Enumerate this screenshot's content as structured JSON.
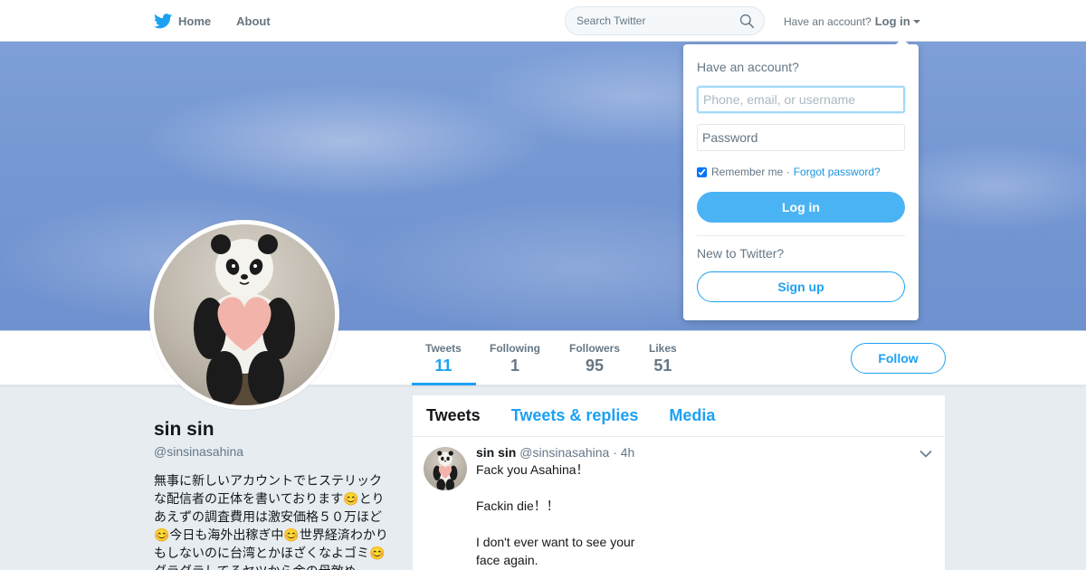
{
  "nav": {
    "home_label": "Home",
    "about_label": "About",
    "search_placeholder": "Search Twitter",
    "account_prompt": "Have an account?",
    "login_label": "Log in"
  },
  "profile": {
    "name": "sin sin",
    "handle": "@sinsinasahina",
    "bio": "無事に新しいアカウントでヒステリックな配信者の正体を書いております😊とりあえずの調査費用は激安価格５０万ほど😊今日も海外出稼ぎ中😊世界経済わかりもしないのに台湾とかほざくなよゴミ😊ダラダラしてるヤツから金の母敵め"
  },
  "stats": [
    {
      "label": "Tweets",
      "value": "11"
    },
    {
      "label": "Following",
      "value": "1"
    },
    {
      "label": "Followers",
      "value": "95"
    },
    {
      "label": "Likes",
      "value": "51"
    }
  ],
  "follow_label": "Follow",
  "timeline": {
    "tabs": [
      "Tweets",
      "Tweets & replies",
      "Media"
    ],
    "active_tab": "Tweets",
    "tweets": [
      {
        "name": "sin sin",
        "handle": "@sinsinasahina",
        "time": "· 4h",
        "text": "Fack you Asahina！\n\nFackin die！！\n\nI don't ever want to see your\nface again."
      }
    ]
  },
  "login_dropdown": {
    "title": "Have an account?",
    "username_placeholder": "Phone, email, or username",
    "password_placeholder": "Password",
    "remember_label": "Remember me ·",
    "forgot_label": "Forgot password?",
    "login_button": "Log in",
    "new_prompt": "New to Twitter?",
    "signup_button": "Sign up"
  },
  "colors": {
    "brand_blue": "#1da1f2",
    "login_button_blue": "#4ab3f4",
    "banner_blue": "#7597d3",
    "page_background": "#e6ecf0"
  },
  "icons": {
    "logo": "twitter-bird-icon",
    "search": "search-icon",
    "tweet_menu": "chevron-down-icon"
  }
}
